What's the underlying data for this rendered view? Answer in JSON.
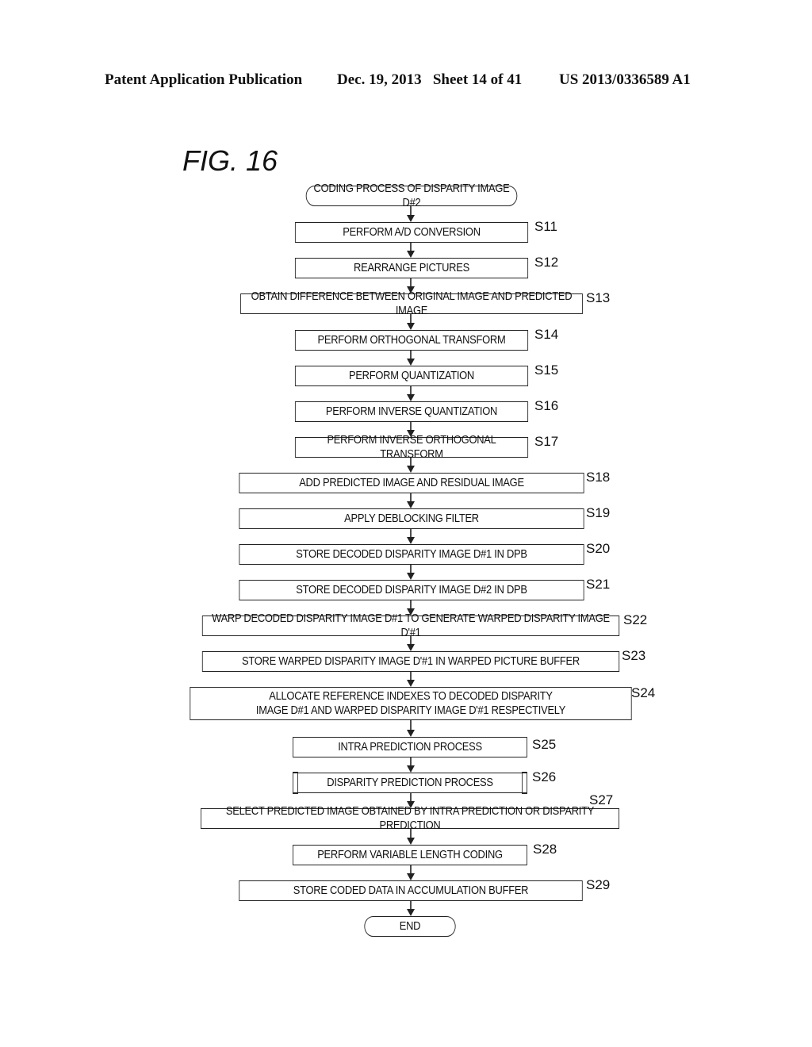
{
  "header": {
    "publication": "Patent Application Publication",
    "date_sheet": "Dec. 19, 2013   Sheet 14 of 41",
    "patent_number": "US 2013/0336589 A1"
  },
  "figure_label": "FIG. 16",
  "flowchart": {
    "start": "CODING PROCESS OF DISPARITY IMAGE D#2",
    "steps": [
      {
        "id": "S11",
        "text": "PERFORM A/D CONVERSION"
      },
      {
        "id": "S12",
        "text": "REARRANGE PICTURES"
      },
      {
        "id": "S13",
        "text": "OBTAIN DIFFERENCE BETWEEN ORIGINAL IMAGE AND PREDICTED IMAGE"
      },
      {
        "id": "S14",
        "text": "PERFORM ORTHOGONAL TRANSFORM"
      },
      {
        "id": "S15",
        "text": "PERFORM QUANTIZATION"
      },
      {
        "id": "S16",
        "text": "PERFORM INVERSE QUANTIZATION"
      },
      {
        "id": "S17",
        "text": "PERFORM INVERSE ORTHOGONAL TRANSFORM"
      },
      {
        "id": "S18",
        "text": "ADD PREDICTED IMAGE AND RESIDUAL IMAGE"
      },
      {
        "id": "S19",
        "text": "APPLY DEBLOCKING FILTER"
      },
      {
        "id": "S20",
        "text": "STORE DECODED DISPARITY IMAGE D#1 IN DPB"
      },
      {
        "id": "S21",
        "text": "STORE DECODED DISPARITY IMAGE D#2 IN DPB"
      },
      {
        "id": "S22",
        "text": "WARP DECODED DISPARITY IMAGE D#1 TO GENERATE WARPED DISPARITY IMAGE D'#1"
      },
      {
        "id": "S23",
        "text": "STORE WARPED DISPARITY IMAGE D'#1 IN WARPED PICTURE BUFFER"
      },
      {
        "id": "S24",
        "text": "ALLOCATE REFERENCE INDEXES TO DECODED DISPARITY",
        "text2": "IMAGE D#1 AND WARPED DISPARITY IMAGE D'#1 RESPECTIVELY"
      },
      {
        "id": "S25",
        "text": "INTRA PREDICTION PROCESS"
      },
      {
        "id": "S26",
        "text": "DISPARITY PREDICTION PROCESS",
        "subroutine": true
      },
      {
        "id": "S27",
        "text": "SELECT PREDICTED IMAGE OBTAINED BY INTRA PREDICTION OR DISPARITY PREDICTION"
      },
      {
        "id": "S28",
        "text": "PERFORM VARIABLE LENGTH CODING"
      },
      {
        "id": "S29",
        "text": "STORE CODED DATA IN ACCUMULATION BUFFER"
      }
    ],
    "end": "END"
  }
}
